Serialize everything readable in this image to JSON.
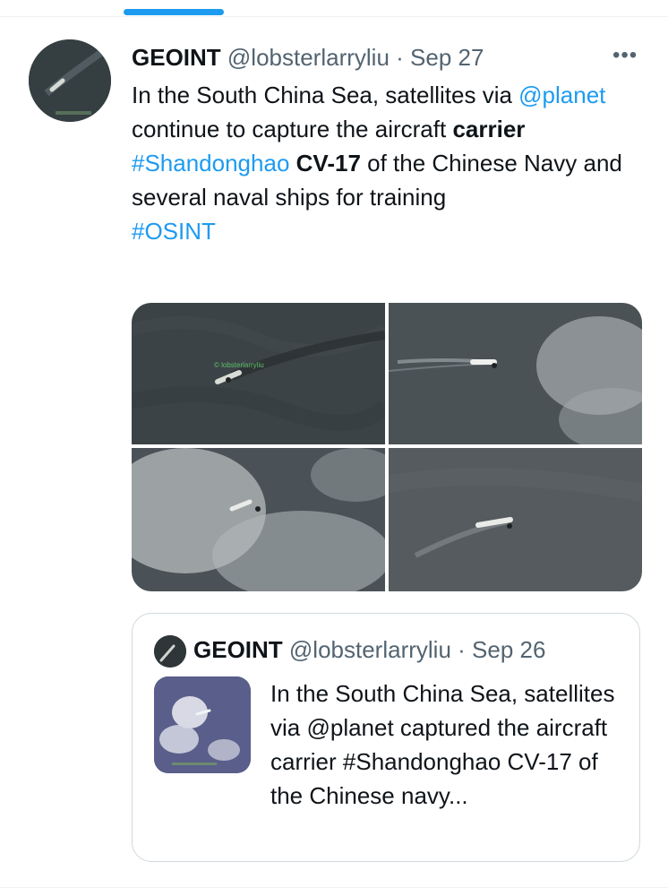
{
  "tweet": {
    "display_name": "GEOINT",
    "handle": "@lobsterlarryliu",
    "separator": "·",
    "date": "Sep 27",
    "more_label": "•••",
    "text": {
      "t1": "In the South China Sea, satellites via ",
      "mention": "@planet",
      "t2": " continue to capture the aircraft ",
      "bold1": "carrier",
      "t3": " ",
      "hashtag1": "#Shandonghao",
      "t4": " ",
      "bold2": "CV-17",
      "t5": " of the Chinese Navy and several naval ships for training",
      "hashtag2": "#OSINT"
    },
    "image_overlay_text": "© lobsterlarryliu"
  },
  "quoted": {
    "display_name": "GEOINT",
    "handle": "@lobsterlarryliu",
    "separator": "·",
    "date": "Sep 26",
    "text": "In the South China Sea, satellites via @planet captured the aircraft carrier #Shandonghao CV-17 of the Chinese navy..."
  },
  "colors": {
    "link": "#1d9bf0",
    "secondary": "#536471",
    "border": "#cfd9de",
    "sea": "#3d4448"
  }
}
